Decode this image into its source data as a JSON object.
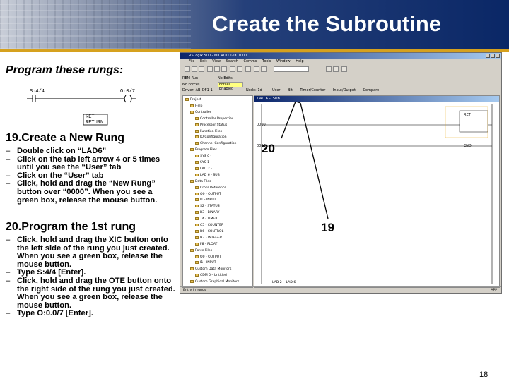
{
  "slide": {
    "title": "Create the Subroutine",
    "subtitle": "Program these rungs:",
    "page_number": "18"
  },
  "ladder_example": {
    "xic_address": "S:4/4",
    "ote_address": "O:0/7",
    "ret_label_1": "RET",
    "ret_label_2": "RETURN"
  },
  "section19": {
    "heading": "19.Create a New Rung",
    "steps": [
      "Double click on “LAD6”",
      "Click on the tab left arrow 4 or 5 times until you see the “User” tab",
      "Click on the “User” tab",
      "Click, hold and drag the “New Rung” button over “0000”. When you see a green box, release the mouse button."
    ]
  },
  "section20": {
    "heading": "20.Program the 1st rung",
    "steps": [
      "Click, hold and drag the XIC button onto the left side of the rung you just created. When you see a green box, release the mouse button.",
      "Type S:4/4 [Enter].",
      "Click, hold and drag the OTE button onto the right side of the rung you just created. When you see a green box, release the mouse button.",
      "Type O:0.0/7 [Enter]."
    ]
  },
  "callouts": {
    "c20": "20",
    "c19": "19"
  },
  "screenshot": {
    "window_title": "RSLogix 500 - MICROLOGIX 1000",
    "menu": [
      "File",
      "Edit",
      "View",
      "Search",
      "Comms",
      "Tools",
      "Window",
      "Help"
    ],
    "status": {
      "mode": "REM Run",
      "forces_off": "No Forces",
      "edits": "No Edits",
      "forces_enabled": "Forces Enabled",
      "driver": "Driver: AB_DF1-1",
      "node": "Node: 1d"
    },
    "instruction_tabs": [
      "User",
      "Bit",
      "Timer/Counter",
      "Input/Output",
      "Compare"
    ],
    "window_name": "LAD 6 -- SUB",
    "rung_labels": {
      "rung0": "0000",
      "rung1": "0001",
      "end": "END",
      "ret": "RET"
    },
    "project_tree": [
      "Project",
      "Help",
      "Controller",
      "Controller Properties",
      "Processor Status",
      "Function Files",
      "IO Configuration",
      "Channel Configuration",
      "Program Files",
      "SYS 0 -",
      "SYS 1 -",
      "LAD 2 -",
      "LAD 6 - SUB",
      "Data Files",
      "Cross Reference",
      "O0 - OUTPUT",
      "I1 - INPUT",
      "S2 - STATUS",
      "B3 - BINARY",
      "T4 - TIMER",
      "C5 - COUNTER",
      "R6 - CONTROL",
      "N7 - INTEGER",
      "F8 - FLOAT",
      "Force Files",
      "O0 - OUTPUT",
      "I1 - INPUT",
      "Custom Data Monitors",
      "CDM 0 - Untitled",
      "Custom Graphical Monitors"
    ],
    "bottom_tabs": [
      "LAD 2",
      "LAD 6"
    ],
    "status_bar": "Entry in rungs",
    "app_label": "APP"
  }
}
